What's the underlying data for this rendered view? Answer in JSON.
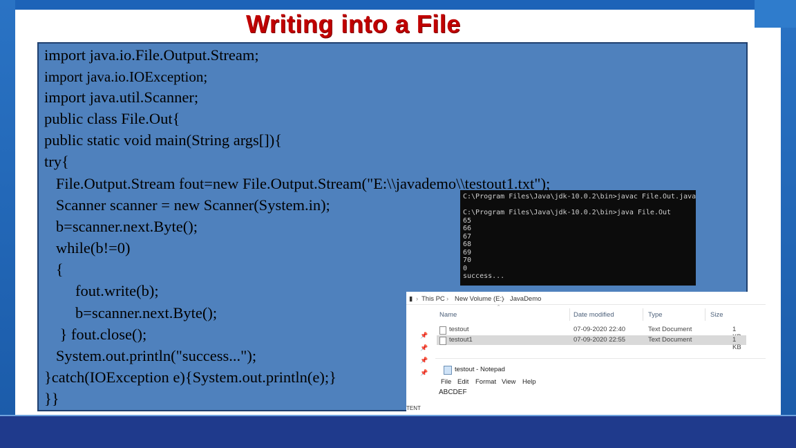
{
  "slide": {
    "title": "Writing into a File"
  },
  "code": {
    "lines": [
      "import java.io.File.Output.Stream;",
      "import java.io.IOException;",
      "import java.util.Scanner;",
      "public class File.Out{",
      "public static void main(String args[]){",
      "try{",
      "   File.Output.Stream fout=new File.Output.Stream(\"E:\\\\javademo\\\\testout1.txt\");",
      "   Scanner scanner = new Scanner(System.in);",
      "   b=scanner.next.Byte();",
      "   while(b!=0)",
      "   {",
      "        fout.write(b);",
      "        b=scanner.next.Byte();",
      "    } fout.close();",
      "   System.out.println(\"success...\");",
      "}catch(IOException e){System.out.println(e);}",
      "}}"
    ]
  },
  "console": {
    "lines": [
      "C:\\Program Files\\Java\\jdk-10.0.2\\bin>javac File.Out.java",
      "",
      "C:\\Program Files\\Java\\jdk-10.0.2\\bin>java File.Out",
      "65",
      "66",
      "67",
      "68",
      "69",
      "70",
      "0",
      "success..."
    ]
  },
  "explorer": {
    "breadcrumb": [
      "This PC",
      "New Volume (E:)",
      "JavaDemo"
    ],
    "columns": [
      "Name",
      "Date modified",
      "Type",
      "Size"
    ],
    "files": [
      {
        "name": "testout",
        "date": "07-09-2020 22:40",
        "type": "Text Document",
        "size": "1 KB",
        "selected": false
      },
      {
        "name": "testout1",
        "date": "07-09-2020 22:55",
        "type": "Text Document",
        "size": "1 KB",
        "selected": true
      }
    ]
  },
  "notepad": {
    "title": "testout - Notepad",
    "menu": [
      "File",
      "Edit",
      "Format",
      "View",
      "Help"
    ],
    "content": "ABCDEF"
  },
  "fragment": {
    "text": "TENT"
  },
  "colors": {
    "code_box": "#4f81bd",
    "title": "#c00000",
    "bottom_bar": "#1f3a8c",
    "frame": "#1d5fb0"
  }
}
